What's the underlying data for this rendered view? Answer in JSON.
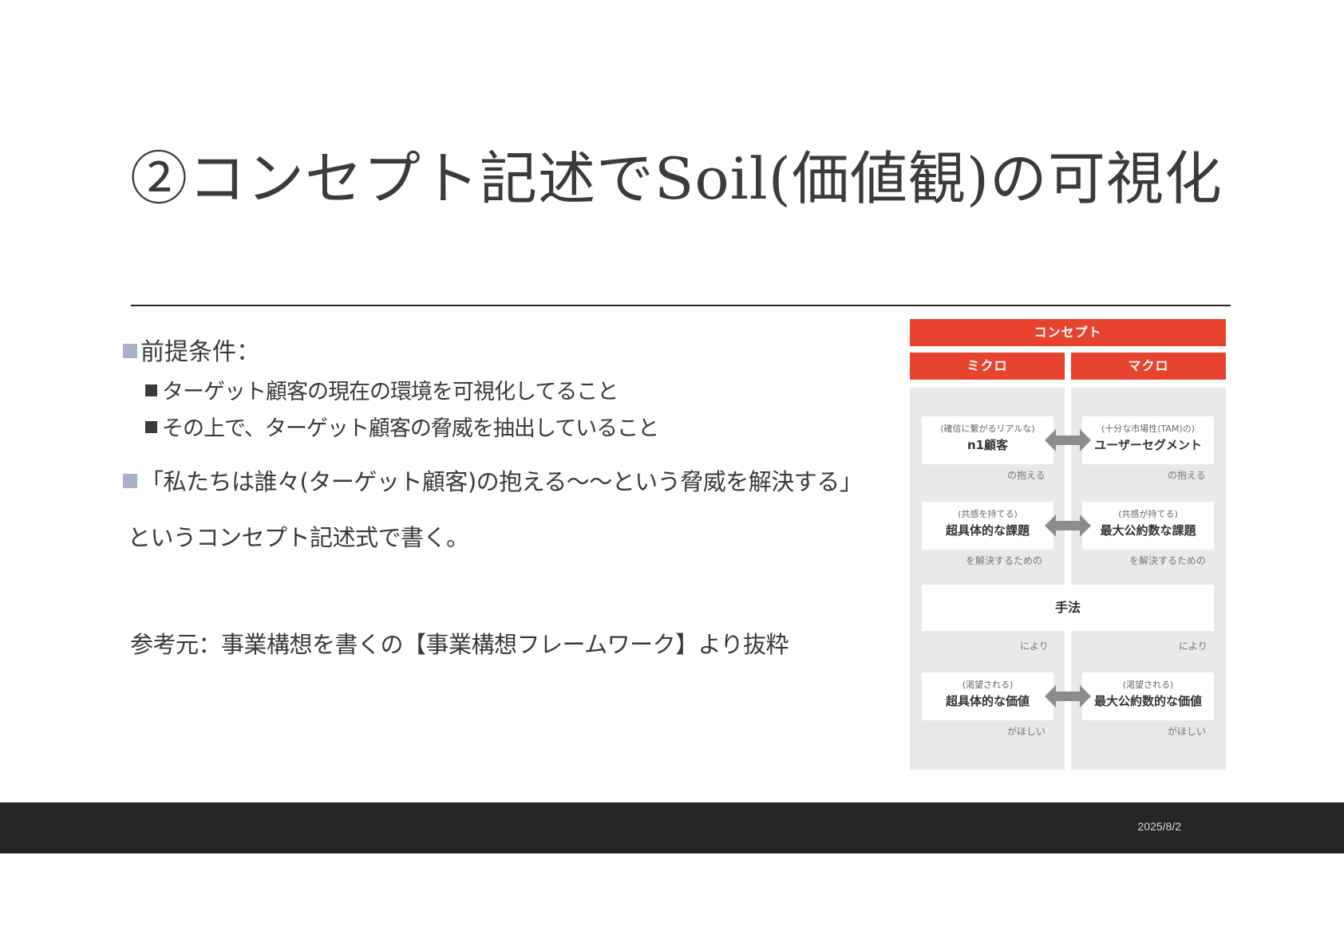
{
  "slide": {
    "title": "②コンセプト記述でSoil(価値観)の可視化",
    "bullets": {
      "premise": "前提条件：",
      "premise_items": [
        "ターゲット顧客の現在の環境を可視化してること",
        "その上で、ターゲット顧客の脅威を抽出していること"
      ],
      "formula": "「私たちは誰々(ターゲット顧客)の抱える～～という脅威を解決する」",
      "formula_note": "というコンセプト記述式で書く。",
      "reference": "参考元：事業構想を書くの【事業構想フレームワーク】より抜粋"
    },
    "footer_date": "2025/8/2"
  },
  "diagram": {
    "header": "コンセプト",
    "micro_label": "ミクロ",
    "macro_label": "マクロ",
    "rows": [
      {
        "micro_small": "(確信に繋がるリアルな)",
        "micro_big": "n1顧客",
        "macro_small": "(十分な市場性(TAM)の)",
        "macro_big": "ユーザーセグメント",
        "suffix": "の抱える"
      },
      {
        "micro_small": "(共感を持てる)",
        "micro_big": "超具体的な課題",
        "macro_small": "(共感が持てる)",
        "macro_big": "最大公約数な課題",
        "suffix": "を解決するための"
      }
    ],
    "method": "手法",
    "method_suffix": "により",
    "last_row": {
      "micro_small": "(渇望される)",
      "micro_big": "超具体的な価値",
      "macro_small": "(渇望される)",
      "macro_big": "最大公約数的な価値",
      "suffix": "がほしい"
    },
    "colors": {
      "accent": "#e8432f",
      "panel": "#e9e9e9",
      "arrow": "#8c8c8c"
    }
  }
}
